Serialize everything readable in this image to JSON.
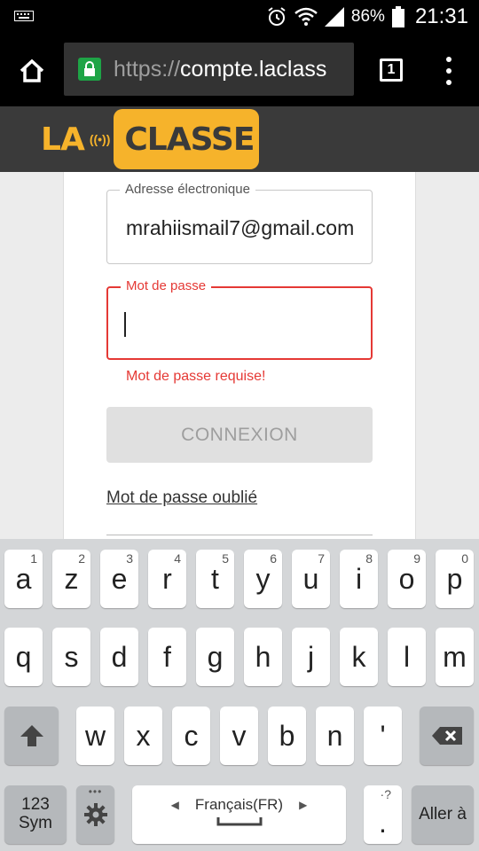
{
  "status_bar": {
    "battery": "86%",
    "time": "21:31"
  },
  "browser": {
    "url_scheme": "https://",
    "url_host": "compte.laclass",
    "tab_count": "1"
  },
  "header": {
    "logo_left": "LA",
    "logo_right": "CLASSE"
  },
  "form": {
    "email_label": "Adresse électronique",
    "email_value": "mrahiismail7@gmail.com",
    "password_label": "Mot de passe",
    "password_value": "",
    "password_error": "Mot de passe requise!",
    "connect_label": "CONNEXION",
    "forgot_label": "Mot de passe oublié"
  },
  "keyboard": {
    "row1": [
      {
        "key": "a",
        "hint": "1"
      },
      {
        "key": "z",
        "hint": "2"
      },
      {
        "key": "e",
        "hint": "3"
      },
      {
        "key": "r",
        "hint": "4"
      },
      {
        "key": "t",
        "hint": "5"
      },
      {
        "key": "y",
        "hint": "6"
      },
      {
        "key": "u",
        "hint": "7"
      },
      {
        "key": "i",
        "hint": "8"
      },
      {
        "key": "o",
        "hint": "9"
      },
      {
        "key": "p",
        "hint": "0"
      }
    ],
    "row2": [
      "q",
      "s",
      "d",
      "f",
      "g",
      "h",
      "j",
      "k",
      "l",
      "m"
    ],
    "row3": [
      "w",
      "x",
      "c",
      "v",
      "b",
      "n",
      "'"
    ],
    "sym_label_1": "123",
    "sym_label_2": "Sym",
    "language": "Français(FR)",
    "period": ".",
    "period_hint": "·?",
    "go_label": "Aller à"
  }
}
